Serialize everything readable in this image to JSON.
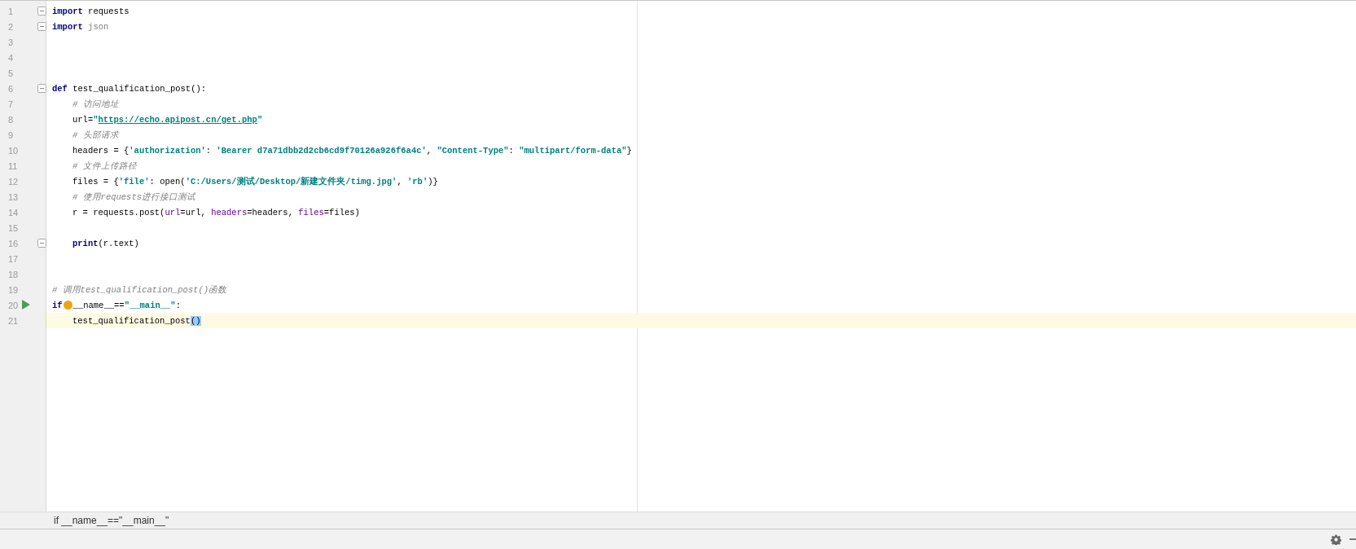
{
  "editor": {
    "lines": [
      {
        "number": "1",
        "fold": true,
        "run": false,
        "bulb": false,
        "current": false,
        "indented": false,
        "tokens": [
          {
            "kind": "keyword",
            "text": "import"
          },
          {
            "kind": "plain",
            "text": " requests"
          }
        ]
      },
      {
        "number": "2",
        "fold": true,
        "run": false,
        "bulb": false,
        "current": false,
        "indented": false,
        "tokens": [
          {
            "kind": "keyword",
            "text": "import"
          },
          {
            "kind": "unused",
            "text": " json"
          }
        ]
      },
      {
        "number": "3",
        "fold": false,
        "run": false,
        "bulb": false,
        "current": false,
        "indented": false
      },
      {
        "number": "4",
        "fold": false,
        "run": false,
        "bulb": false,
        "current": false,
        "indented": false
      },
      {
        "number": "5",
        "fold": false,
        "run": false,
        "bulb": false,
        "current": false,
        "indented": false
      },
      {
        "number": "6",
        "fold": true,
        "run": false,
        "bulb": false,
        "current": false,
        "indented": false,
        "tokens": [
          {
            "kind": "keyword",
            "text": "def"
          },
          {
            "kind": "plain",
            "text": " test_qualification_post():"
          }
        ]
      },
      {
        "number": "7",
        "fold": false,
        "run": false,
        "bulb": false,
        "current": false,
        "indented": true,
        "tokens": [
          {
            "kind": "comment",
            "text": "# 访问地址"
          }
        ]
      },
      {
        "number": "8",
        "fold": false,
        "run": false,
        "bulb": false,
        "current": false,
        "indented": true,
        "tokens": [
          {
            "kind": "plain",
            "text": "url="
          },
          {
            "kind": "string",
            "text": "\""
          },
          {
            "kind": "link",
            "text": "https://echo.apipost.cn/get.php"
          },
          {
            "kind": "string",
            "text": "\""
          }
        ]
      },
      {
        "number": "9",
        "fold": false,
        "run": false,
        "bulb": false,
        "current": false,
        "indented": true,
        "tokens": [
          {
            "kind": "comment",
            "text": "# 头部请求"
          }
        ]
      },
      {
        "number": "10",
        "fold": false,
        "run": false,
        "bulb": false,
        "current": false,
        "indented": true,
        "tokens": [
          {
            "kind": "plain",
            "text": "headers = {"
          },
          {
            "kind": "string",
            "text": "'authorization'"
          },
          {
            "kind": "plain",
            "text": ": "
          },
          {
            "kind": "string",
            "text": "'Bearer d7a71dbb2d2cb6cd9f70126a926f6a4c'"
          },
          {
            "kind": "plain",
            "text": ", "
          },
          {
            "kind": "string",
            "text": "\"Content-Type\""
          },
          {
            "kind": "plain",
            "text": ": "
          },
          {
            "kind": "string",
            "text": "\"multipart/form-data\""
          },
          {
            "kind": "plain",
            "text": "}"
          }
        ]
      },
      {
        "number": "11",
        "fold": false,
        "run": false,
        "bulb": false,
        "current": false,
        "indented": true,
        "tokens": [
          {
            "kind": "comment",
            "text": "# 文件上传路径"
          }
        ]
      },
      {
        "number": "12",
        "fold": false,
        "run": false,
        "bulb": false,
        "current": false,
        "indented": true,
        "tokens": [
          {
            "kind": "plain",
            "text": "files = {"
          },
          {
            "kind": "string",
            "text": "'file'"
          },
          {
            "kind": "plain",
            "text": ": open("
          },
          {
            "kind": "string",
            "text": "'C:/Users/测试/Desktop/新建文件夹/timg.jpg'"
          },
          {
            "kind": "plain",
            "text": ", "
          },
          {
            "kind": "string",
            "text": "'rb'"
          },
          {
            "kind": "plain",
            "text": ")}"
          }
        ]
      },
      {
        "number": "13",
        "fold": false,
        "run": false,
        "bulb": false,
        "current": false,
        "indented": true,
        "tokens": [
          {
            "kind": "comment",
            "text": "# 使用requests进行接口测试"
          }
        ]
      },
      {
        "number": "14",
        "fold": false,
        "run": false,
        "bulb": false,
        "current": false,
        "indented": true,
        "tokens": [
          {
            "kind": "plain",
            "text": "r = requests.post("
          },
          {
            "kind": "param",
            "text": "url"
          },
          {
            "kind": "plain",
            "text": "=url, "
          },
          {
            "kind": "param",
            "text": "headers"
          },
          {
            "kind": "plain",
            "text": "=headers, "
          },
          {
            "kind": "param",
            "text": "files"
          },
          {
            "kind": "plain",
            "text": "=files)"
          }
        ]
      },
      {
        "number": "15",
        "fold": false,
        "run": false,
        "bulb": false,
        "current": false,
        "indented": false
      },
      {
        "number": "16",
        "fold": true,
        "run": false,
        "bulb": false,
        "current": false,
        "indented": true,
        "tokens": [
          {
            "kind": "keyword",
            "text": "print"
          },
          {
            "kind": "plain",
            "text": "(r.text)"
          }
        ]
      },
      {
        "number": "17",
        "fold": false,
        "run": false,
        "bulb": false,
        "current": false,
        "indented": false
      },
      {
        "number": "18",
        "fold": false,
        "run": false,
        "bulb": false,
        "current": false,
        "indented": false
      },
      {
        "number": "19",
        "fold": false,
        "run": false,
        "bulb": false,
        "current": false,
        "indented": false,
        "tokens": [
          {
            "kind": "comment",
            "text": "# 调用test_qualification_post()函数"
          }
        ]
      },
      {
        "number": "20",
        "fold": false,
        "run": true,
        "bulb": true,
        "current": false,
        "indented": false,
        "tokens": [
          {
            "kind": "keyword",
            "text": "if"
          },
          {
            "kind": "plain",
            "text": "__name__=="
          },
          {
            "kind": "string",
            "text": "\"__main__\""
          },
          {
            "kind": "plain",
            "text": ":"
          }
        ]
      },
      {
        "number": "21",
        "fold": false,
        "run": false,
        "bulb": false,
        "current": true,
        "indented": true,
        "tokens": [
          {
            "kind": "plain",
            "text": "test_qualification_post"
          },
          {
            "kind": "match",
            "text": "()"
          }
        ]
      }
    ]
  },
  "breadcrumb": "if __name__==\"__main__\""
}
